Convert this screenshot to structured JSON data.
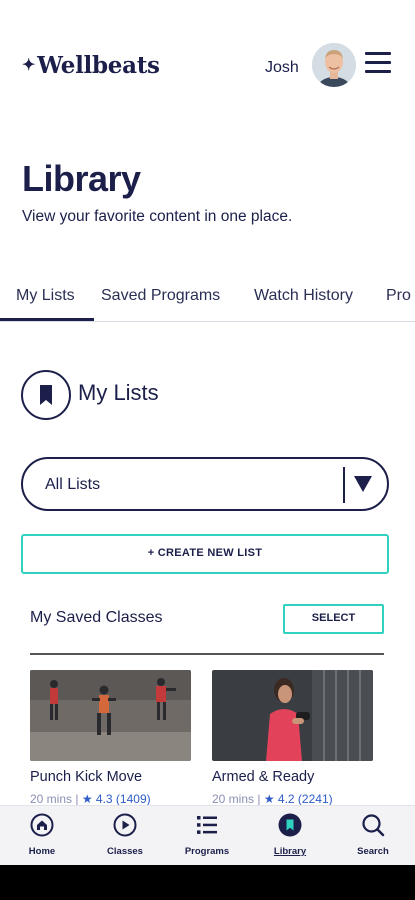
{
  "header": {
    "logo_star": "✦",
    "logo_text": "Wellbeats",
    "user_name": "Josh"
  },
  "page": {
    "title": "Library",
    "subtitle": "View your favorite content in one place."
  },
  "tabs": [
    {
      "label": "My Lists",
      "active": true
    },
    {
      "label": "Saved Programs",
      "active": false
    },
    {
      "label": "Watch History",
      "active": false
    },
    {
      "label": "Pro",
      "active": false
    }
  ],
  "lists_section": {
    "title": "My Lists",
    "selected_list": "All Lists",
    "create_button": "+ CREATE NEW LIST"
  },
  "saved_classes": {
    "title": "My Saved Classes",
    "select_button": "SELECT",
    "items": [
      {
        "title": "Punch Kick Move",
        "duration": "20 mins |",
        "rating": "★ 4.3 (1409)"
      },
      {
        "title": "Armed & Ready",
        "duration": "20 mins |",
        "rating": "★ 4.2 (2241)"
      }
    ]
  },
  "bottom_nav": [
    {
      "label": "Home",
      "icon": "home-icon"
    },
    {
      "label": "Classes",
      "icon": "play-icon"
    },
    {
      "label": "Programs",
      "icon": "list-icon"
    },
    {
      "label": "Library",
      "icon": "bookmark-icon",
      "active": true
    },
    {
      "label": "Search",
      "icon": "search-icon"
    }
  ],
  "colors": {
    "navy": "#1b1f4a",
    "teal": "#2fd1bf",
    "nav_bg": "#f3f3f6"
  }
}
